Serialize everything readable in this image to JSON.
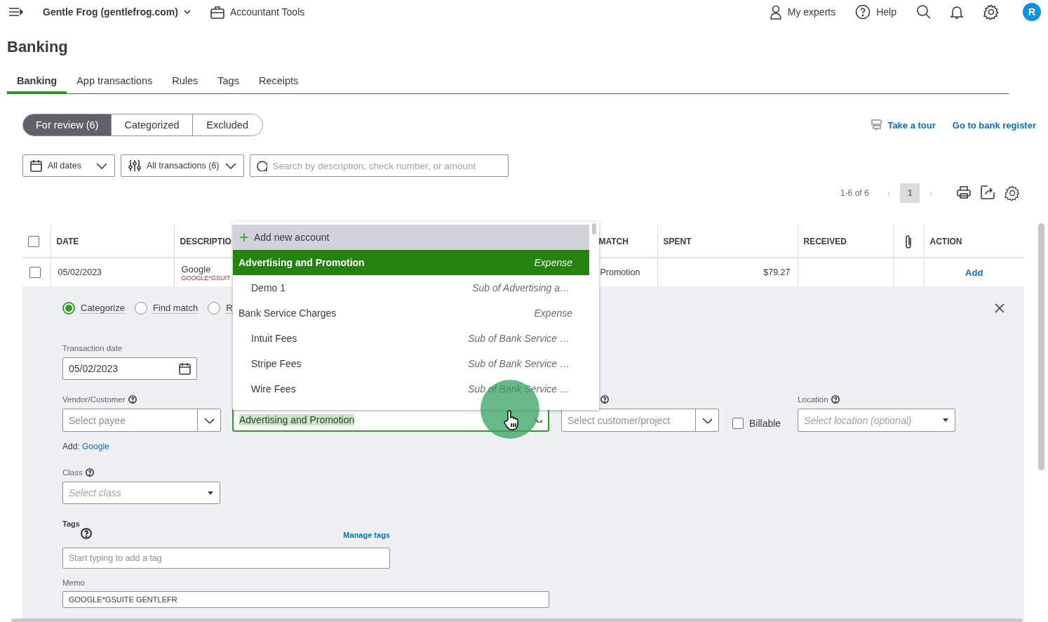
{
  "top_bar": {
    "company": "Gentle Frog (gentlefrog.com)",
    "accountant_tools": "Accountant Tools",
    "my_experts": "My experts",
    "help": "Help",
    "avatar": "R"
  },
  "page_title": "Banking",
  "tabs": [
    {
      "label": "Banking",
      "selected": true
    },
    {
      "label": "App transactions",
      "selected": false
    },
    {
      "label": "Rules",
      "selected": false
    },
    {
      "label": "Tags",
      "selected": false
    },
    {
      "label": "Receipts",
      "selected": false
    }
  ],
  "review_tabs": [
    {
      "label": "For review (6)",
      "selected": true
    },
    {
      "label": "Categorized",
      "selected": false
    },
    {
      "label": "Excluded",
      "selected": false
    }
  ],
  "links": {
    "take_tour": "Take a tour",
    "bank_register": "Go to bank register"
  },
  "filters": {
    "dates": "All dates",
    "transactions": "All transactions (6)",
    "search_placeholder": "Search by description, check number, or amount"
  },
  "pagination": {
    "range": "1-6 of 6",
    "previous": "‹",
    "next": "›",
    "pages": [
      {
        "label": "1",
        "selected": true
      }
    ]
  },
  "table": {
    "columns": [
      {
        "kind": "checkbox",
        "checked": false
      },
      {
        "kind": "text",
        "label": "DATE"
      },
      {
        "kind": "text",
        "label": "DESCRIPTIO"
      },
      {
        "kind": "blank"
      },
      {
        "kind": "text",
        "label": "MATCH"
      },
      {
        "kind": "text",
        "label": "SPENT"
      },
      {
        "kind": "text",
        "label": "RECEIVED"
      },
      {
        "kind": "attachment"
      },
      {
        "kind": "text",
        "label": "ACTION"
      }
    ],
    "rows": [
      {
        "checked": false,
        "date": "05/02/2023",
        "description": "Google",
        "bank_detail": "GOOGLE*GSUIT",
        "match": "Promotion",
        "spent": "$79.27",
        "action": "Add"
      }
    ]
  },
  "detail": {
    "options": [
      {
        "label": "Categorize",
        "selected": true
      },
      {
        "label": "Find match",
        "selected": false
      },
      {
        "label": "R",
        "selected": false
      }
    ],
    "transaction_date": {
      "label": "Transaction date",
      "value": "05/02/2023"
    },
    "vendor": {
      "label": "Vendor/Customer",
      "placeholder": "Select payee"
    },
    "category": {
      "value": "Advertising and Promotion"
    },
    "customer": {
      "placeholder": "Select customer/project"
    },
    "billable": {
      "label": "Billable",
      "checked": false
    },
    "location": {
      "label": "Location",
      "placeholder": "Select location (optional)"
    },
    "add_prefix": "Add:",
    "add_link": "Google",
    "class": {
      "label": "Class",
      "placeholder": "Select class"
    },
    "tags": {
      "label": "Tags",
      "manage": "Manage tags",
      "placeholder": "Start typing to add a tag"
    },
    "memo": {
      "label": "Memo",
      "value": "GOOGLE*GSUITE GENTLEFR"
    }
  },
  "account_menu": {
    "add_new": "Add new account",
    "items": [
      {
        "name": "Advertising and Promotion",
        "detail": "Expense",
        "selected": true,
        "children": [
          {
            "name": "Demo 1",
            "detail": "Sub of Advertising a…",
            "selected": false
          }
        ]
      },
      {
        "name": "Bank Service Charges",
        "detail": "Expense",
        "selected": false,
        "children": [
          {
            "name": "Intuit Fees",
            "detail": "Sub of Bank Service …",
            "selected": false
          },
          {
            "name": "Stripe Fees",
            "detail": "Sub of Bank Service …",
            "selected": false
          },
          {
            "name": "Wire Fees",
            "detail": "Sub of Bank Service …",
            "selected": false
          }
        ]
      }
    ]
  }
}
